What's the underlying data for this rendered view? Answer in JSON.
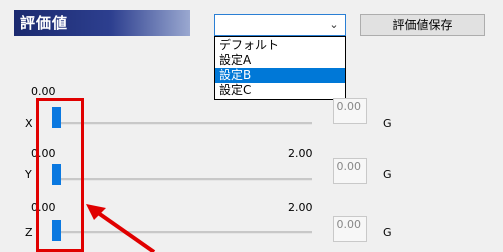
{
  "header": {
    "title": "評価値"
  },
  "dropdown": {
    "selected_value": "",
    "arrow_icon": "chevron-down-icon",
    "options": [
      "デフォルト",
      "設定A",
      "設定B",
      "設定C"
    ],
    "highlighted_index": 2
  },
  "toolbar": {
    "save_label": "評価値保存"
  },
  "sliders": [
    {
      "axis": "X",
      "min_label": "0.00",
      "max_label": "",
      "value": "0.00",
      "unit": "G",
      "level": 0
    },
    {
      "axis": "Y",
      "min_label": "0.00",
      "max_label": "2.00",
      "value": "0.00",
      "unit": "G",
      "level": 0
    },
    {
      "axis": "Z",
      "min_label": "0.00",
      "max_label": "2.00",
      "value": "0.00",
      "unit": "G",
      "level": 0
    }
  ],
  "colors": {
    "selection": "#0078d7",
    "slider_thumb": "#0a78e0",
    "annotation": "#e00000"
  }
}
